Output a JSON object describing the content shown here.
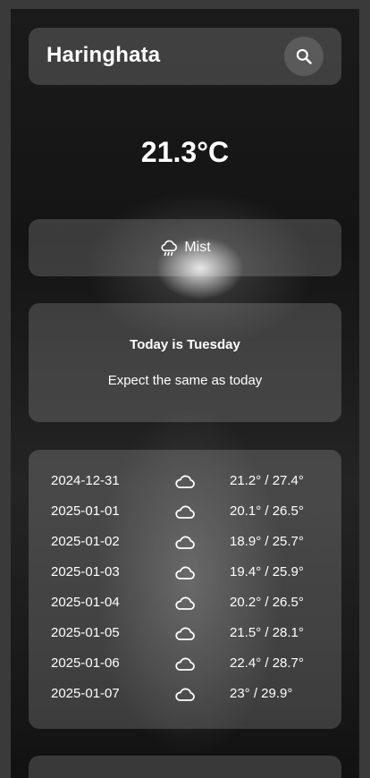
{
  "header": {
    "city": "Haringhata",
    "search_icon": "search-icon"
  },
  "current": {
    "temperature": "21.3°C",
    "condition": "Mist",
    "condition_icon": "cloud-rain-icon"
  },
  "today": {
    "title": "Today is Tuesday",
    "message": "Expect the same as today"
  },
  "forecast": [
    {
      "date": "2024-12-31",
      "icon": "cloud-icon",
      "range": "21.2° / 27.4°"
    },
    {
      "date": "2025-01-01",
      "icon": "cloud-icon",
      "range": "20.1° / 26.5°"
    },
    {
      "date": "2025-01-02",
      "icon": "cloud-icon",
      "range": "18.9° / 25.7°"
    },
    {
      "date": "2025-01-03",
      "icon": "cloud-icon",
      "range": "19.4° / 25.9°"
    },
    {
      "date": "2025-01-04",
      "icon": "cloud-icon",
      "range": "20.2° / 26.5°"
    },
    {
      "date": "2025-01-05",
      "icon": "cloud-icon",
      "range": "21.5° / 28.1°"
    },
    {
      "date": "2025-01-06",
      "icon": "cloud-icon",
      "range": "22.4° / 28.7°"
    },
    {
      "date": "2025-01-07",
      "icon": "cloud-icon",
      "range": "23° / 29.9°"
    }
  ]
}
